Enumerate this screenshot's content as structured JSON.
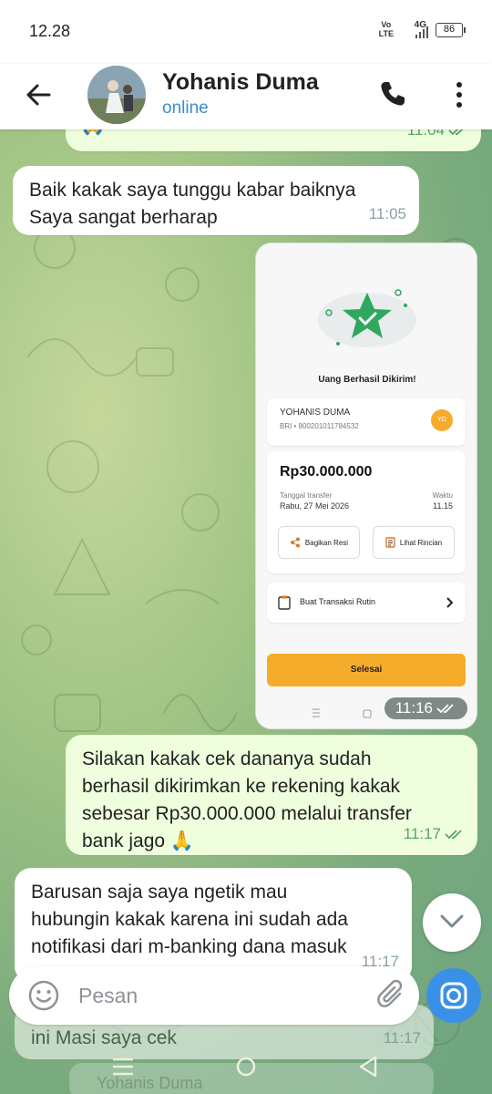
{
  "status": {
    "time": "12.28",
    "volte_top": "Vo",
    "volte_bottom": "LTE",
    "network": "4G",
    "battery": "86"
  },
  "header": {
    "contact_name": "Yohanis Duma",
    "contact_status": "online"
  },
  "messages": {
    "m0": {
      "text": "🙏",
      "time": "11:04"
    },
    "m1": {
      "line1": "Baik kakak saya tunggu kabar baiknya",
      "line2": "Saya sangat berharap",
      "time": "11:05"
    },
    "m2": {
      "time": "11:16"
    },
    "m3": {
      "line1": "Silakan kakak cek dananya sudah",
      "line2": "berhasil dikirimkan ke rekening kakak",
      "line3": "sebesar Rp30.000.000 melalui transfer",
      "line4": "bank jago 🙏",
      "time": "11:17"
    },
    "m4": {
      "line1": "Barusan saja saya ngetik mau",
      "line2": "hubungin kakak karena ini sudah ada",
      "line3": "notifikasi dari m-banking dana masuk",
      "time": "11:17"
    },
    "m5": {
      "text": "ini Masi saya cek",
      "time": "11:17"
    }
  },
  "receipt": {
    "title": "Uang Berhasil Dikirim!",
    "recipient_name": "YOHANIS DUMA",
    "recipient_account": "BRI • 800201011784532",
    "recipient_initials": "YD",
    "amount": "Rp30.000.000",
    "date_label": "Tanggal transfer",
    "date_value": "Rabu, 27 Mei 2026",
    "time_label": "Waktu",
    "time_value": "11.15",
    "share_label": "Bagikan Resi",
    "details_label": "Lihat Rincian",
    "routine_label": "Buat Transaksi Rutin",
    "finish_label": "Selesai"
  },
  "composer": {
    "placeholder": "Pesan"
  },
  "below_composer": {
    "preview": "Yohanis Duma"
  },
  "colors": {
    "accent": "#3a90e6",
    "outgoing_bubble": "#effedd",
    "incoming_bubble": "#ffffff",
    "online": "#3a8fd0",
    "read_check": "#5aa462",
    "receipt_button": "#f6ac2b",
    "receipt_green": "#2fa75e"
  },
  "icons": [
    "back-arrow-icon",
    "phone-icon",
    "more-vertical-icon",
    "emoji-icon",
    "attach-icon",
    "camera-icon",
    "chevron-down-icon",
    "double-check-icon"
  ]
}
